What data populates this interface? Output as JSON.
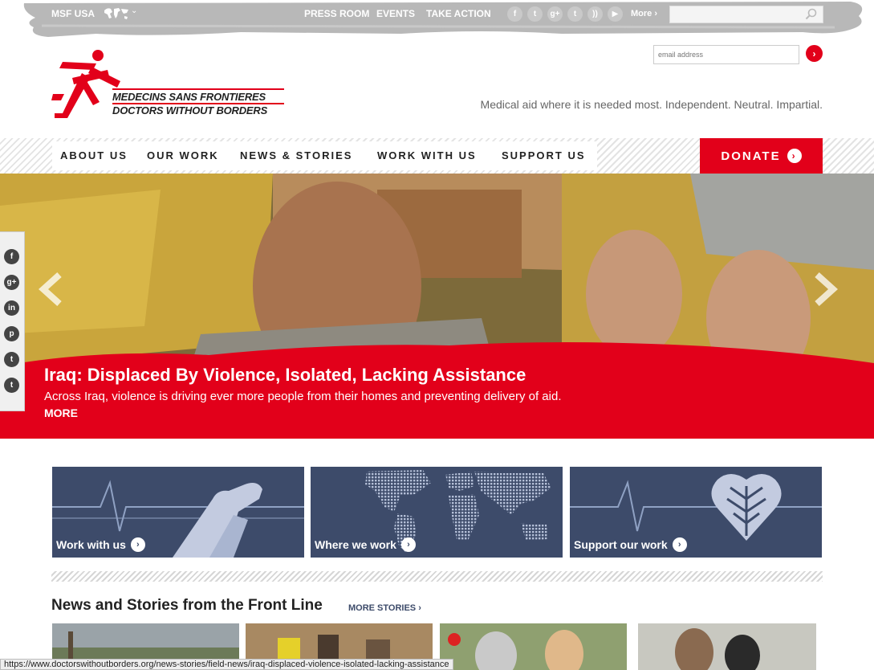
{
  "topbar": {
    "site": "MSF USA",
    "links": [
      "PRESS ROOM",
      "EVENTS",
      "TAKE ACTION"
    ],
    "social": [
      {
        "icon": "facebook-icon",
        "glyph": "f"
      },
      {
        "icon": "twitter-icon",
        "glyph": "t"
      },
      {
        "icon": "google-plus-icon",
        "glyph": "g+"
      },
      {
        "icon": "tumblr-icon",
        "glyph": "t"
      },
      {
        "icon": "rss-icon",
        "glyph": "))"
      },
      {
        "icon": "youtube-icon",
        "glyph": "▶"
      }
    ],
    "more": "More ›",
    "search_value": ""
  },
  "header": {
    "logo_line1": "MEDECINS SANS FRONTIERES",
    "logo_line2": "DOCTORS WITHOUT BORDERS",
    "email_placeholder": "email address",
    "tagline": "Medical aid where it is needed most. Independent. Neutral. Impartial."
  },
  "nav": {
    "items": [
      "ABOUT US",
      "OUR WORK",
      "NEWS & STORIES",
      "WORK WITH US",
      "SUPPORT US"
    ],
    "donate": "DONATE"
  },
  "hero": {
    "title": "Iraq: Displaced By Violence, Isolated, Lacking Assistance",
    "subtitle": "Across Iraq, violence is driving ever more people from their homes and preventing delivery of aid.",
    "more": "MORE"
  },
  "share": [
    "facebook-icon",
    "google-plus-icon",
    "linkedin-icon",
    "pinterest-icon",
    "tumblr-icon",
    "twitter-icon"
  ],
  "tiles": [
    {
      "label": "Work with us"
    },
    {
      "label": "Where we work"
    },
    {
      "label": "Support our work"
    }
  ],
  "news": {
    "heading": "News and Stories from the Front Line",
    "more": "MORE STORIES ›"
  },
  "status_url": "https://www.doctorswithoutborders.org/news-stories/field-news/iraq-displaced-violence-isolated-lacking-assistance",
  "colors": {
    "brand_red": "#e2001a",
    "tile_blue": "#3d4b6a",
    "brush_gray": "#b8b8b8"
  }
}
